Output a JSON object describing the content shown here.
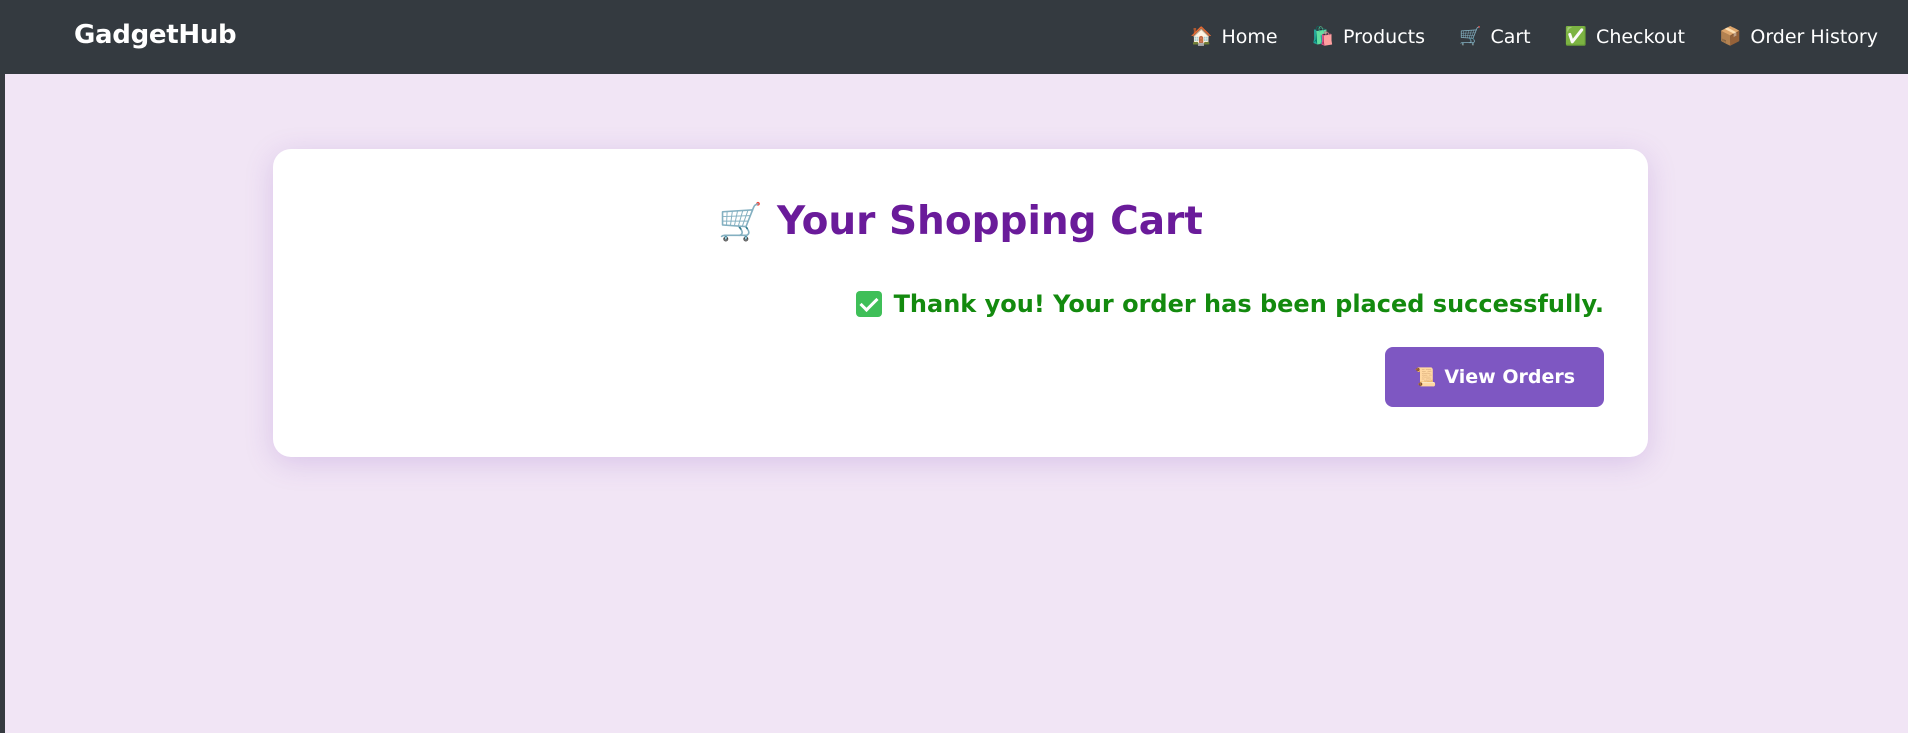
{
  "navbar": {
    "brand": "GadgetHub",
    "links": [
      {
        "icon": "🏠",
        "icon_name": "home-icon",
        "label": "Home"
      },
      {
        "icon": "🛍️",
        "icon_name": "shopping-bags-icon",
        "label": "Products"
      },
      {
        "icon": "🛒",
        "icon_name": "cart-icon",
        "label": "Cart"
      },
      {
        "icon": "✅",
        "icon_name": "check-icon",
        "label": "Checkout"
      },
      {
        "icon": "📦",
        "icon_name": "package-icon",
        "label": "Order History"
      }
    ]
  },
  "cart": {
    "title_icon": "🛒",
    "title": "Your Shopping Cart",
    "success_message": "Thank you! Your order has been placed successfully.",
    "view_orders_icon": "📜",
    "view_orders_label": "View Orders"
  },
  "colors": {
    "navbar_bg": "#343a40",
    "page_bg": "#f1e5f5",
    "title": "#6a1b9a",
    "success": "#138a0e",
    "button": "#7e57c2"
  }
}
